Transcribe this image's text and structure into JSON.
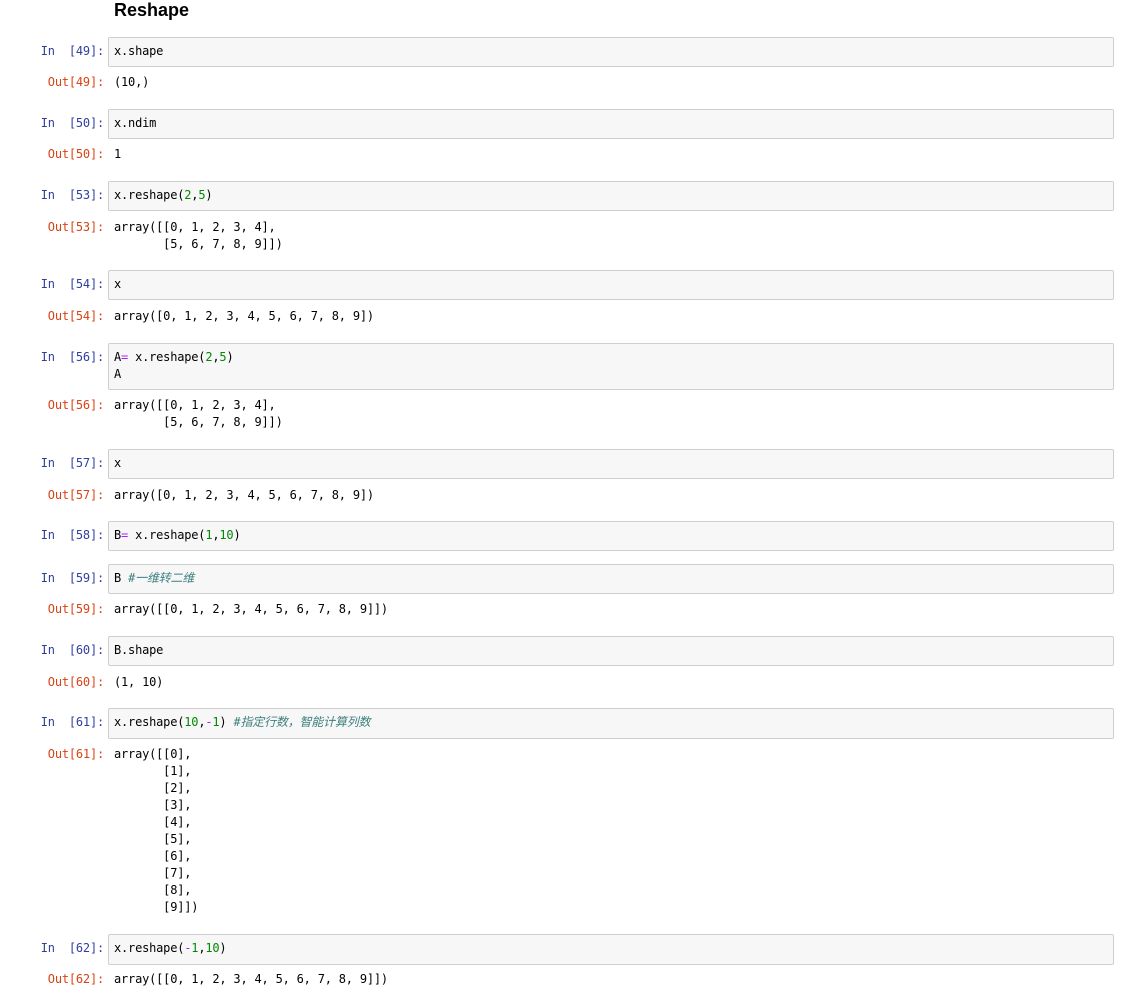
{
  "heading": "Reshape",
  "cells": [
    {
      "in_prompt": "In  [49]:",
      "out_prompt": "Out[49]:",
      "code": [
        {
          "t": "x.shape",
          "c": "var"
        }
      ],
      "output": "(10,)"
    },
    {
      "in_prompt": "In  [50]:",
      "out_prompt": "Out[50]:",
      "code": [
        {
          "t": "x.ndim",
          "c": "var"
        }
      ],
      "output": "1"
    },
    {
      "in_prompt": "In  [53]:",
      "out_prompt": "Out[53]:",
      "code": [
        {
          "t": "x.reshape(",
          "c": "var"
        },
        {
          "t": "2",
          "c": "num"
        },
        {
          "t": ",",
          "c": "var"
        },
        {
          "t": "5",
          "c": "num"
        },
        {
          "t": ")",
          "c": "var"
        }
      ],
      "output": "array([[0, 1, 2, 3, 4],\n       [5, 6, 7, 8, 9]])"
    },
    {
      "in_prompt": "In  [54]:",
      "out_prompt": "Out[54]:",
      "code": [
        {
          "t": "x",
          "c": "var"
        }
      ],
      "output": "array([0, 1, 2, 3, 4, 5, 6, 7, 8, 9])"
    },
    {
      "in_prompt": "In  [56]:",
      "out_prompt": "Out[56]:",
      "code": [
        {
          "t": "A",
          "c": "var"
        },
        {
          "t": "=",
          "c": "op"
        },
        {
          "t": " x.reshape(",
          "c": "var"
        },
        {
          "t": "2",
          "c": "num"
        },
        {
          "t": ",",
          "c": "var"
        },
        {
          "t": "5",
          "c": "num"
        },
        {
          "t": ")\nA",
          "c": "var"
        }
      ],
      "output": "array([[0, 1, 2, 3, 4],\n       [5, 6, 7, 8, 9]])"
    },
    {
      "in_prompt": "In  [57]:",
      "out_prompt": "Out[57]:",
      "code": [
        {
          "t": "x",
          "c": "var"
        }
      ],
      "output": "array([0, 1, 2, 3, 4, 5, 6, 7, 8, 9])"
    },
    {
      "in_prompt": "In  [58]:",
      "out_prompt": "",
      "code": [
        {
          "t": "B",
          "c": "var"
        },
        {
          "t": "=",
          "c": "op"
        },
        {
          "t": " x.reshape(",
          "c": "var"
        },
        {
          "t": "1",
          "c": "num"
        },
        {
          "t": ",",
          "c": "var"
        },
        {
          "t": "10",
          "c": "num"
        },
        {
          "t": ")",
          "c": "var"
        }
      ],
      "output": ""
    },
    {
      "in_prompt": "In  [59]:",
      "out_prompt": "Out[59]:",
      "code": [
        {
          "t": "B ",
          "c": "var"
        },
        {
          "t": "#一维转二维",
          "c": "cm"
        }
      ],
      "output": "array([[0, 1, 2, 3, 4, 5, 6, 7, 8, 9]])"
    },
    {
      "in_prompt": "In  [60]:",
      "out_prompt": "Out[60]:",
      "code": [
        {
          "t": "B.shape",
          "c": "var"
        }
      ],
      "output": "(1, 10)"
    },
    {
      "in_prompt": "In  [61]:",
      "out_prompt": "Out[61]:",
      "code": [
        {
          "t": "x.reshape(",
          "c": "var"
        },
        {
          "t": "10",
          "c": "num"
        },
        {
          "t": ",",
          "c": "var"
        },
        {
          "t": "-",
          "c": "op"
        },
        {
          "t": "1",
          "c": "num"
        },
        {
          "t": ") ",
          "c": "var"
        },
        {
          "t": "#指定行数，智能计算列数",
          "c": "cm"
        }
      ],
      "output": "array([[0],\n       [1],\n       [2],\n       [3],\n       [4],\n       [5],\n       [6],\n       [7],\n       [8],\n       [9]])"
    },
    {
      "in_prompt": "In  [62]:",
      "out_prompt": "Out[62]:",
      "code": [
        {
          "t": "x.reshape(",
          "c": "var"
        },
        {
          "t": "-",
          "c": "op"
        },
        {
          "t": "1",
          "c": "num"
        },
        {
          "t": ",",
          "c": "var"
        },
        {
          "t": "10",
          "c": "num"
        },
        {
          "t": ")",
          "c": "var"
        }
      ],
      "output": "array([[0, 1, 2, 3, 4, 5, 6, 7, 8, 9]])"
    }
  ]
}
